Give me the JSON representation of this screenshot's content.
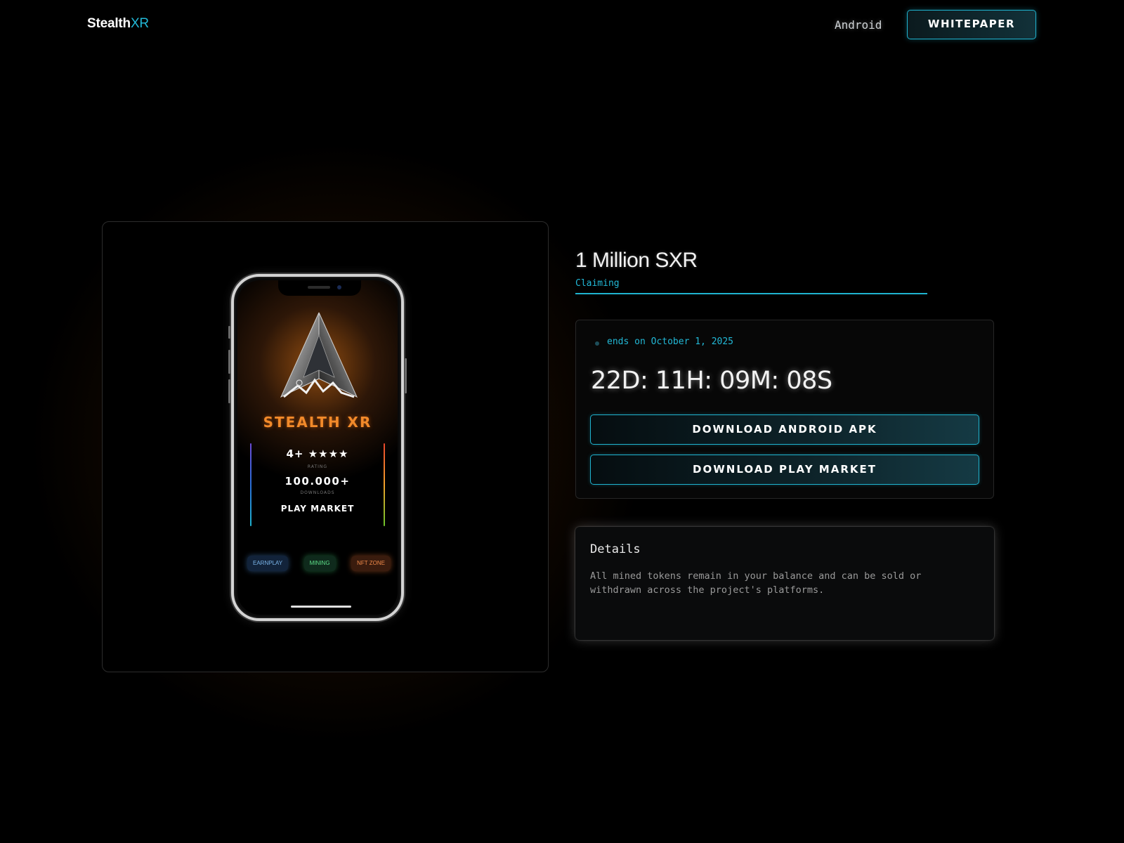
{
  "header": {
    "logo_main": "Stealth",
    "logo_accent": "XR",
    "nav_android": "Android",
    "nav_whitepaper": "Whitepaper"
  },
  "hero": {
    "app_title": "STEALTH XR",
    "rating_label": "4+ ★★★★",
    "rating_caption": "Rating",
    "downloads_label": "100.000+",
    "downloads_caption": "Downloads",
    "market_label": "Play Market",
    "pills": [
      "EARNPLAY",
      "MINING",
      "NFT ZONE"
    ]
  },
  "claim": {
    "title": "1 Million SXR",
    "subtitle": "Claiming",
    "ends_text": "ends on October 1, 2025",
    "countdown": "22D: 11H: 09M: 08S",
    "download_apk_label": "Download Android APK",
    "download_play_label": "Download Play Market"
  },
  "details": {
    "title": "Details",
    "text": "All mined tokens remain in your balance and can be sold or withdrawn across the project's platforms."
  },
  "colors": {
    "accent": "#22b8d6",
    "brand_orange": "#f28a2a",
    "background": "#000000"
  },
  "icons": {
    "emblem": "stealth-jet-emblem-icon",
    "status_dot": "status-dot-icon"
  }
}
